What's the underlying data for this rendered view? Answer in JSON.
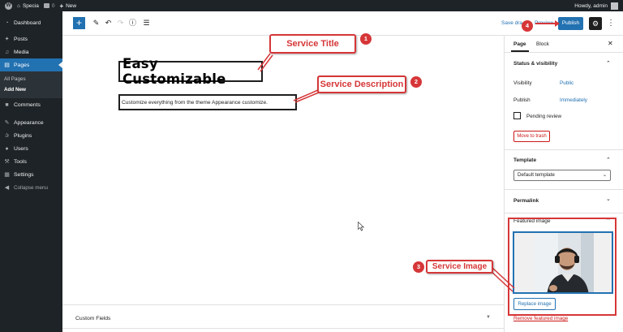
{
  "adminbar": {
    "site_name": "Specia",
    "comments_count": "0",
    "new_label": "New",
    "howdy": "Howdy, admin"
  },
  "sidebar": {
    "items": [
      {
        "label": "Dashboard",
        "icon": "dashboard-icon"
      },
      {
        "label": "Posts",
        "icon": "pin-icon"
      },
      {
        "label": "Media",
        "icon": "media-icon"
      },
      {
        "label": "Pages",
        "icon": "pages-icon"
      },
      {
        "label": "Comments",
        "icon": "comments-icon"
      },
      {
        "label": "Appearance",
        "icon": "brush-icon"
      },
      {
        "label": "Plugins",
        "icon": "plugin-icon"
      },
      {
        "label": "Users",
        "icon": "users-icon"
      },
      {
        "label": "Tools",
        "icon": "wrench-icon"
      },
      {
        "label": "Settings",
        "icon": "settings-icon"
      },
      {
        "label": "Collapse menu",
        "icon": "collapse-icon"
      }
    ],
    "submenu": [
      "All Pages",
      "Add New"
    ]
  },
  "header": {
    "save_draft": "Save dra",
    "preview": "Preview",
    "publish": "Publish"
  },
  "canvas": {
    "title": "Easy Customizable",
    "description": "Customize everything from the theme Appearance customize.",
    "custom_fields": "Custom Fields"
  },
  "panel": {
    "tab_page": "Page",
    "tab_block": "Block",
    "status_title": "Status & visibility",
    "visibility_label": "Visibility",
    "visibility_value": "Public",
    "publish_label": "Publish",
    "publish_value": "Immediately",
    "pending_review": "Pending review",
    "move_to_trash": "Move to trash",
    "template_title": "Template",
    "template_value": "Default template",
    "permalink_title": "Permalink",
    "featured_title": "Featured image",
    "replace_image": "Replace image",
    "remove_image": "Remove featured image"
  },
  "annotations": {
    "service_title": "Service Title",
    "service_description": "Service Description",
    "service_image": "Service Image",
    "badge_1": "1",
    "badge_2": "2",
    "badge_3": "3",
    "badge_4": "4"
  },
  "colors": {
    "admin_dark": "#1d2327",
    "accent_blue": "#2271b1",
    "annotation_red": "#d63638",
    "danger_red": "#cc1818"
  }
}
